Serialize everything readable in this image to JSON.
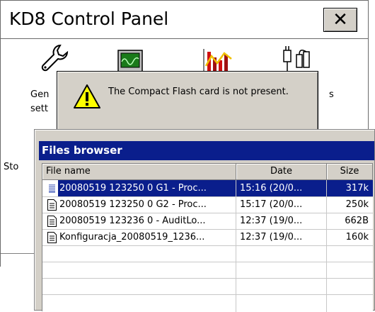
{
  "control_panel": {
    "title": "KD8 Control Panel",
    "close_symbol": "✕",
    "items": [
      {
        "icon": "wrench-icon",
        "label_line1": "Gen",
        "label_line2": "sett"
      },
      {
        "icon": "oscilloscope-icon",
        "label_line1": "",
        "label_line2": ""
      },
      {
        "icon": "chart-icon",
        "label_line1": "",
        "label_line2": ""
      },
      {
        "icon": "plug-icon",
        "label_line1": "s",
        "label_line2": ""
      }
    ],
    "status_partial": "Sto"
  },
  "message_box": {
    "icon": "warning-icon",
    "text": "The Compact Flash card is not present."
  },
  "files_browser": {
    "title": "Files browser",
    "columns": [
      "File name",
      "Date",
      "Size"
    ],
    "rows": [
      {
        "name": "20080519 123250 0 G1 - Proc...",
        "date": "15:16 (20/0...",
        "size": "317k",
        "icon": "data-file-icon",
        "selected": true
      },
      {
        "name": "20080519 123250 0 G2 - Proc...",
        "date": "15:17 (20/0...",
        "size": "250k",
        "icon": "document-icon",
        "selected": false
      },
      {
        "name": "20080519 123236 0 - AuditLo...",
        "date": "12:37 (19/0...",
        "size": "662B",
        "icon": "document-icon",
        "selected": false
      },
      {
        "name": "Konfiguracja_20080519_1236...",
        "date": "12:37 (19/0...",
        "size": "160k",
        "icon": "document-icon",
        "selected": false
      }
    ]
  },
  "colors": {
    "title_bar": "#0a1e8c",
    "dialog_face": "#d4d0c8",
    "warning_yellow": "#ffff00"
  }
}
